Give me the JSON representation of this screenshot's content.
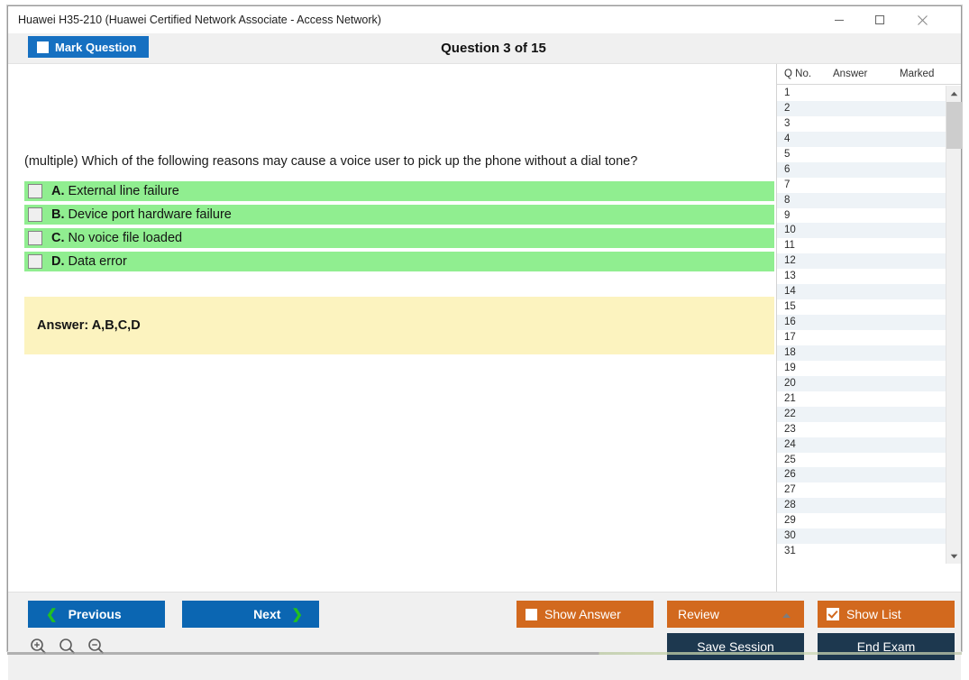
{
  "window": {
    "title": "Huawei H35-210 (Huawei Certified Network Associate - Access Network)",
    "controls": {
      "minimize": "minimize-icon",
      "maximize": "maximize-icon",
      "close": "close-icon"
    }
  },
  "header": {
    "mark_question_label": "Mark Question",
    "mark_question_checked": false,
    "question_counter": "Question 3 of 15"
  },
  "question": {
    "stem": "(multiple) Which of the following reasons may cause a voice user to pick up the phone without a dial tone?",
    "options": [
      {
        "letter": "A.",
        "text": "External line failure",
        "checked": false
      },
      {
        "letter": "B.",
        "text": "Device port hardware failure",
        "checked": false
      },
      {
        "letter": "C.",
        "text": "No voice file loaded",
        "checked": false
      },
      {
        "letter": "D.",
        "text": "Data error",
        "checked": false
      }
    ],
    "answer_label": "Answer: A,B,C,D"
  },
  "question_list": {
    "columns": [
      "Q No.",
      "Answer",
      "Marked"
    ],
    "rows": [
      {
        "qno": "1",
        "answer": "",
        "marked": ""
      },
      {
        "qno": "2",
        "answer": "",
        "marked": ""
      },
      {
        "qno": "3",
        "answer": "",
        "marked": ""
      },
      {
        "qno": "4",
        "answer": "",
        "marked": ""
      },
      {
        "qno": "5",
        "answer": "",
        "marked": ""
      },
      {
        "qno": "6",
        "answer": "",
        "marked": ""
      },
      {
        "qno": "7",
        "answer": "",
        "marked": ""
      },
      {
        "qno": "8",
        "answer": "",
        "marked": ""
      },
      {
        "qno": "9",
        "answer": "",
        "marked": ""
      },
      {
        "qno": "10",
        "answer": "",
        "marked": ""
      },
      {
        "qno": "11",
        "answer": "",
        "marked": ""
      },
      {
        "qno": "12",
        "answer": "",
        "marked": ""
      },
      {
        "qno": "13",
        "answer": "",
        "marked": ""
      },
      {
        "qno": "14",
        "answer": "",
        "marked": ""
      },
      {
        "qno": "15",
        "answer": "",
        "marked": ""
      },
      {
        "qno": "16",
        "answer": "",
        "marked": ""
      },
      {
        "qno": "17",
        "answer": "",
        "marked": ""
      },
      {
        "qno": "18",
        "answer": "",
        "marked": ""
      },
      {
        "qno": "19",
        "answer": "",
        "marked": ""
      },
      {
        "qno": "20",
        "answer": "",
        "marked": ""
      },
      {
        "qno": "21",
        "answer": "",
        "marked": ""
      },
      {
        "qno": "22",
        "answer": "",
        "marked": ""
      },
      {
        "qno": "23",
        "answer": "",
        "marked": ""
      },
      {
        "qno": "24",
        "answer": "",
        "marked": ""
      },
      {
        "qno": "25",
        "answer": "",
        "marked": ""
      },
      {
        "qno": "26",
        "answer": "",
        "marked": ""
      },
      {
        "qno": "27",
        "answer": "",
        "marked": ""
      },
      {
        "qno": "28",
        "answer": "",
        "marked": ""
      },
      {
        "qno": "29",
        "answer": "",
        "marked": ""
      },
      {
        "qno": "30",
        "answer": "",
        "marked": ""
      },
      {
        "qno": "31",
        "answer": "",
        "marked": ""
      }
    ]
  },
  "footer": {
    "previous_label": "Previous",
    "next_label": "Next",
    "show_answer_label": "Show Answer",
    "show_answer_checked": false,
    "review_label": "Review",
    "show_list_label": "Show List",
    "show_list_checked": true,
    "save_session_label": "Save Session",
    "end_exam_label": "End Exam",
    "zoom_icons": [
      "zoom-in-icon",
      "zoom-reset-icon",
      "zoom-out-icon"
    ]
  },
  "colors": {
    "accent_blue": "#0b66b2",
    "accent_orange": "#d2691e",
    "navy": "#1d384f",
    "option_green": "#90ee90",
    "answer_yellow": "#fcf3bf",
    "chevron_green": "#22c020"
  }
}
